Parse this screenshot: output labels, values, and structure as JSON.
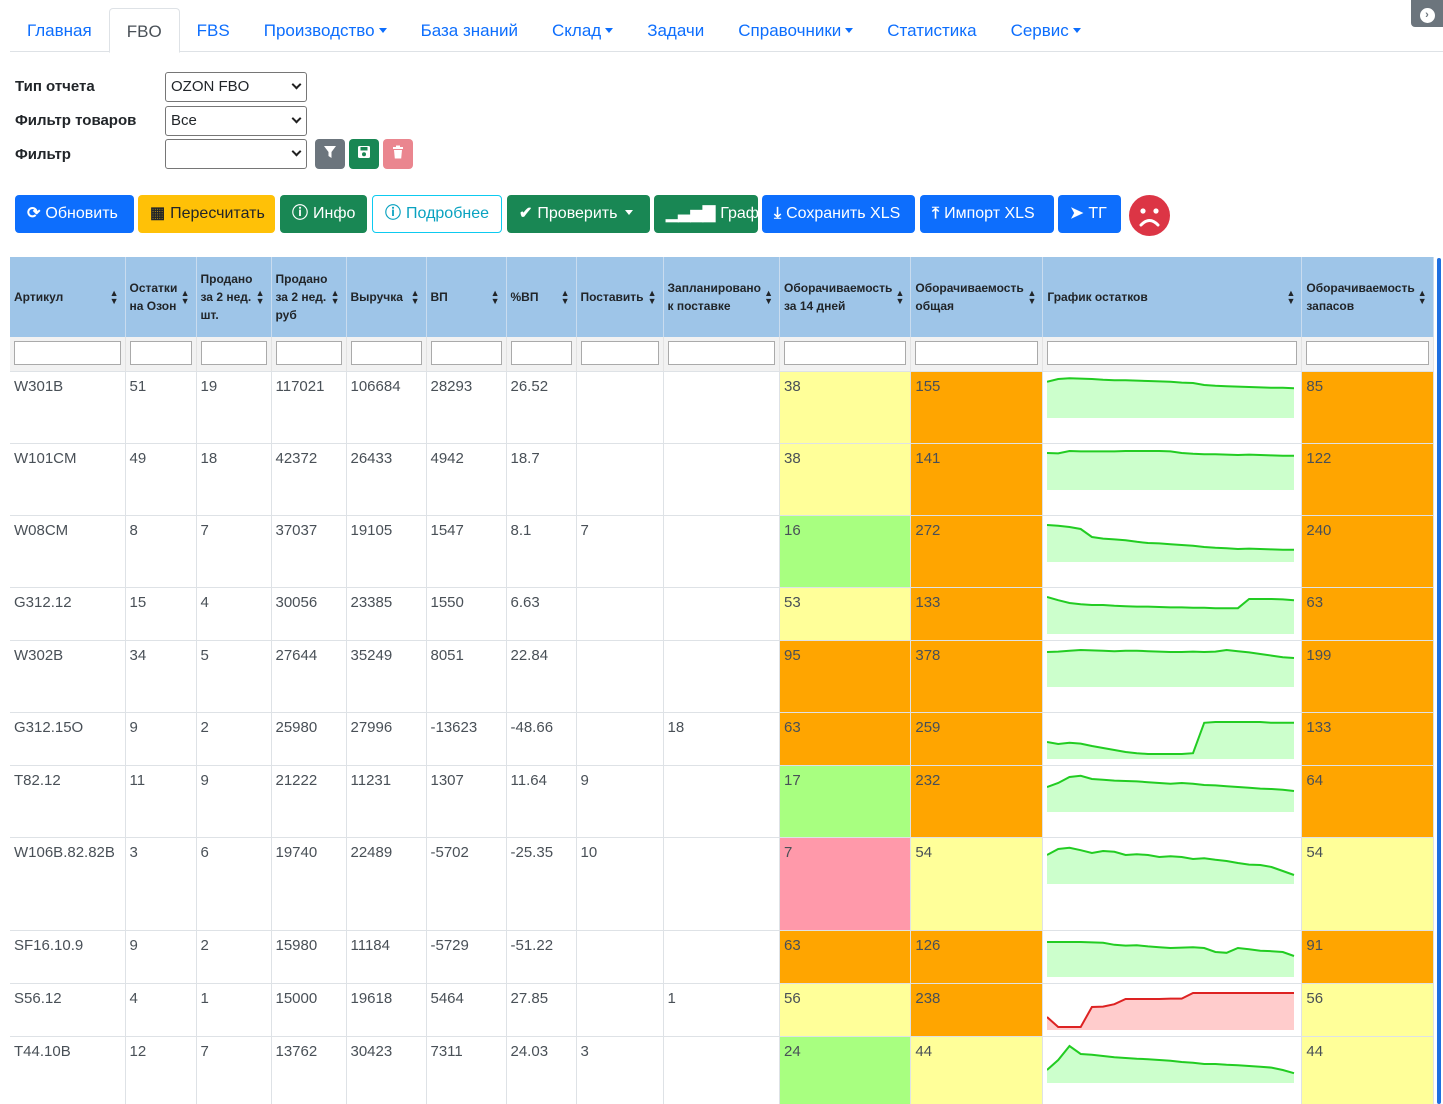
{
  "nav": {
    "tabs": [
      {
        "label": "Главная"
      },
      {
        "label": "FBO"
      },
      {
        "label": "FBS"
      },
      {
        "label": "Производство"
      },
      {
        "label": "База знаний"
      },
      {
        "label": "Склад"
      },
      {
        "label": "Задачи"
      },
      {
        "label": "Справочники"
      },
      {
        "label": "Статистика"
      },
      {
        "label": "Сервис"
      }
    ],
    "active_tab": "FBO"
  },
  "form": {
    "report_type_label": "Тип отчета",
    "report_type_value": "OZON FBO",
    "product_filter_label": "Фильтр товаров",
    "product_filter_value": "Все",
    "filter_label": "Фильтр",
    "filter_value": ""
  },
  "toolbar": {
    "refresh": "Обновить",
    "recalculate": "Пересчитать",
    "info": "Инфо",
    "details": "Подробнее",
    "check": "Проверить",
    "chart": "График",
    "save_xls": "Сохранить XLS",
    "import_xls": "Импорт XLS",
    "tg": "ТГ"
  },
  "colors": {
    "yellow": "#ffff99",
    "green": "#a8ff80",
    "orange": "#ffa500",
    "pink": "#ff99aa",
    "spark_green_line": "#22cc22",
    "spark_green_fill": "#ccffcc",
    "spark_red_line": "#dd2222",
    "spark_red_fill": "#ffcccc"
  },
  "table": {
    "headers": [
      "Артикул",
      "Остатки на Озон",
      "Продано за 2 нед. шт.",
      "Продано за 2 нед. руб",
      "Выручка",
      "ВП",
      "%ВП",
      "Поставить",
      "Запланировано к поставке",
      "Оборачиваемость за 14 дней",
      "Оборачиваемость общая",
      "График остатков",
      "Оборачиваемость запасов"
    ],
    "rows": [
      {
        "sku": "W301B",
        "stock": "51",
        "sold_qty": "19",
        "sold_rub": "117021",
        "revenue": "106684",
        "gp": "28293",
        "gp_pct": "26.52",
        "supply": "",
        "planned": "",
        "turn14": "38",
        "turn14_color": "yellow",
        "turn_total": "155",
        "turn_total_color": "orange",
        "stock_chart": {
          "color": "green",
          "values": [
            88,
            95,
            97,
            96,
            95,
            93,
            92,
            92,
            91,
            90,
            89,
            88,
            86,
            85,
            80,
            78,
            77,
            76,
            75,
            74,
            73,
            73,
            72
          ]
        },
        "turn_inv": "85",
        "turn_inv_color": "orange"
      },
      {
        "sku": "W101CM",
        "stock": "49",
        "sold_qty": "18",
        "sold_rub": "42372",
        "revenue": "26433",
        "gp": "4942",
        "gp_pct": "18.7",
        "supply": "",
        "planned": "",
        "turn14": "38",
        "turn14_color": "yellow",
        "turn_total": "141",
        "turn_total_color": "orange",
        "stock_chart": {
          "color": "green",
          "values": [
            90,
            89,
            95,
            94,
            94,
            94,
            94,
            95,
            95,
            95,
            95,
            94,
            90,
            88,
            87,
            87,
            86,
            85,
            86,
            85,
            84,
            83,
            83
          ]
        },
        "turn_inv": "122",
        "turn_inv_color": "orange"
      },
      {
        "sku": "W08CM",
        "stock": "8",
        "sold_qty": "7",
        "sold_rub": "37037",
        "revenue": "19105",
        "gp": "1547",
        "gp_pct": "8.1",
        "supply": "7",
        "planned": "",
        "turn14": "16",
        "turn14_color": "green",
        "turn_total": "272",
        "turn_total_color": "orange",
        "stock_chart": {
          "color": "green",
          "values": [
            90,
            88,
            85,
            80,
            60,
            56,
            54,
            52,
            48,
            45,
            44,
            42,
            40,
            38,
            35,
            33,
            32,
            30,
            31,
            30,
            29,
            28,
            28
          ]
        },
        "turn_inv": "240",
        "turn_inv_color": "orange"
      },
      {
        "sku": "G312.12",
        "stock": "15",
        "sold_qty": "4",
        "sold_rub": "30056",
        "revenue": "23385",
        "gp": "1550",
        "gp_pct": "6.63",
        "supply": "",
        "planned": "",
        "turn14": "53",
        "turn14_color": "yellow",
        "turn_total": "133",
        "turn_total_color": "orange",
        "stock_chart": {
          "color": "green",
          "values": [
            90,
            82,
            75,
            72,
            70,
            70,
            68,
            67,
            66,
            66,
            65,
            64,
            64,
            63,
            63,
            62,
            62,
            62,
            85,
            85,
            85,
            84,
            82
          ]
        },
        "turn_inv": "63",
        "turn_inv_color": "orange"
      },
      {
        "sku": "W302B",
        "stock": "34",
        "sold_qty": "5",
        "sold_rub": "27644",
        "revenue": "35249",
        "gp": "8051",
        "gp_pct": "22.84",
        "supply": "",
        "planned": "",
        "turn14": "95",
        "turn14_color": "orange",
        "turn_total": "378",
        "turn_total_color": "orange",
        "stock_chart": {
          "color": "green",
          "values": [
            85,
            86,
            88,
            90,
            89,
            88,
            87,
            88,
            88,
            87,
            86,
            85,
            85,
            86,
            85,
            86,
            90,
            87,
            84,
            80,
            76,
            72,
            70
          ]
        },
        "turn_inv": "199",
        "turn_inv_color": "orange"
      },
      {
        "sku": "G312.15O",
        "stock": "9",
        "sold_qty": "2",
        "sold_rub": "25980",
        "revenue": "27996",
        "gp": "-13623",
        "gp_pct": "-48.66",
        "supply": "",
        "planned": "18",
        "turn14": "63",
        "turn14_color": "orange",
        "turn_total": "259",
        "turn_total_color": "orange",
        "stock_chart": {
          "color": "green",
          "values": [
            40,
            35,
            38,
            36,
            30,
            25,
            20,
            15,
            12,
            10,
            10,
            10,
            10,
            12,
            88,
            90,
            90,
            90,
            90,
            90,
            88,
            88,
            88
          ]
        },
        "turn_inv": "133",
        "turn_inv_color": "orange"
      },
      {
        "sku": "T82.12",
        "stock": "11",
        "sold_qty": "9",
        "sold_rub": "21222",
        "revenue": "11231",
        "gp": "1307",
        "gp_pct": "11.64",
        "supply": "9",
        "planned": "",
        "turn14": "17",
        "turn14_color": "green",
        "turn_total": "232",
        "turn_total_color": "orange",
        "stock_chart": {
          "color": "green",
          "values": [
            60,
            70,
            85,
            88,
            80,
            78,
            76,
            75,
            74,
            72,
            70,
            68,
            70,
            68,
            65,
            64,
            62,
            60,
            58,
            56,
            55,
            53,
            50
          ]
        },
        "turn_inv": "64",
        "turn_inv_color": "orange"
      },
      {
        "sku": "W106B.82.82B",
        "stock": "3",
        "sold_qty": "6",
        "sold_rub": "19740",
        "revenue": "22489",
        "gp": "-5702",
        "gp_pct": "-25.35",
        "supply": "10",
        "planned": "",
        "turn14": "7",
        "turn14_color": "pink",
        "turn_total": "54",
        "turn_total_color": "yellow",
        "stock_chart": {
          "color": "green",
          "values": [
            70,
            85,
            88,
            82,
            75,
            80,
            78,
            70,
            72,
            70,
            65,
            67,
            65,
            60,
            62,
            58,
            55,
            50,
            46,
            45,
            40,
            30,
            20
          ]
        },
        "turn_inv": "54",
        "turn_inv_color": "yellow"
      },
      {
        "sku": "SF16.10.9",
        "stock": "9",
        "sold_qty": "2",
        "sold_rub": "15980",
        "revenue": "11184",
        "gp": "-5729",
        "gp_pct": "-51.22",
        "supply": "",
        "planned": "",
        "turn14": "63",
        "turn14_color": "orange",
        "turn_total": "126",
        "turn_total_color": "orange",
        "stock_chart": {
          "color": "green",
          "values": [
            85,
            85,
            85,
            85,
            84,
            83,
            78,
            76,
            77,
            74,
            72,
            70,
            71,
            72,
            70,
            60,
            58,
            70,
            67,
            63,
            62,
            60,
            50
          ]
        },
        "turn_inv": "91",
        "turn_inv_color": "orange"
      },
      {
        "sku": "S56.12",
        "stock": "4",
        "sold_qty": "1",
        "sold_rub": "15000",
        "revenue": "19618",
        "gp": "5464",
        "gp_pct": "27.85",
        "supply": "",
        "planned": "1",
        "turn14": "56",
        "turn14_color": "yellow",
        "turn_total": "238",
        "turn_total_color": "orange",
        "stock_chart": {
          "color": "red",
          "values": [
            30,
            5,
            5,
            5,
            55,
            56,
            62,
            75,
            75,
            75,
            75,
            76,
            76,
            90,
            90,
            90,
            90,
            90,
            90,
            90,
            90,
            90,
            90
          ]
        },
        "turn_inv": "56",
        "turn_inv_color": "yellow"
      },
      {
        "sku": "T44.10B",
        "stock": "12",
        "sold_qty": "7",
        "sold_rub": "13762",
        "revenue": "30423",
        "gp": "7311",
        "gp_pct": "24.03",
        "supply": "3",
        "planned": "",
        "turn14": "24",
        "turn14_color": "green",
        "turn_total": "44",
        "turn_total_color": "yellow",
        "stock_chart": {
          "color": "green",
          "values": [
            30,
            55,
            90,
            70,
            68,
            65,
            62,
            60,
            58,
            57,
            55,
            53,
            50,
            48,
            45,
            45,
            43,
            42,
            40,
            38,
            36,
            30,
            22
          ]
        },
        "turn_inv": "44",
        "turn_inv_color": "yellow"
      }
    ]
  }
}
